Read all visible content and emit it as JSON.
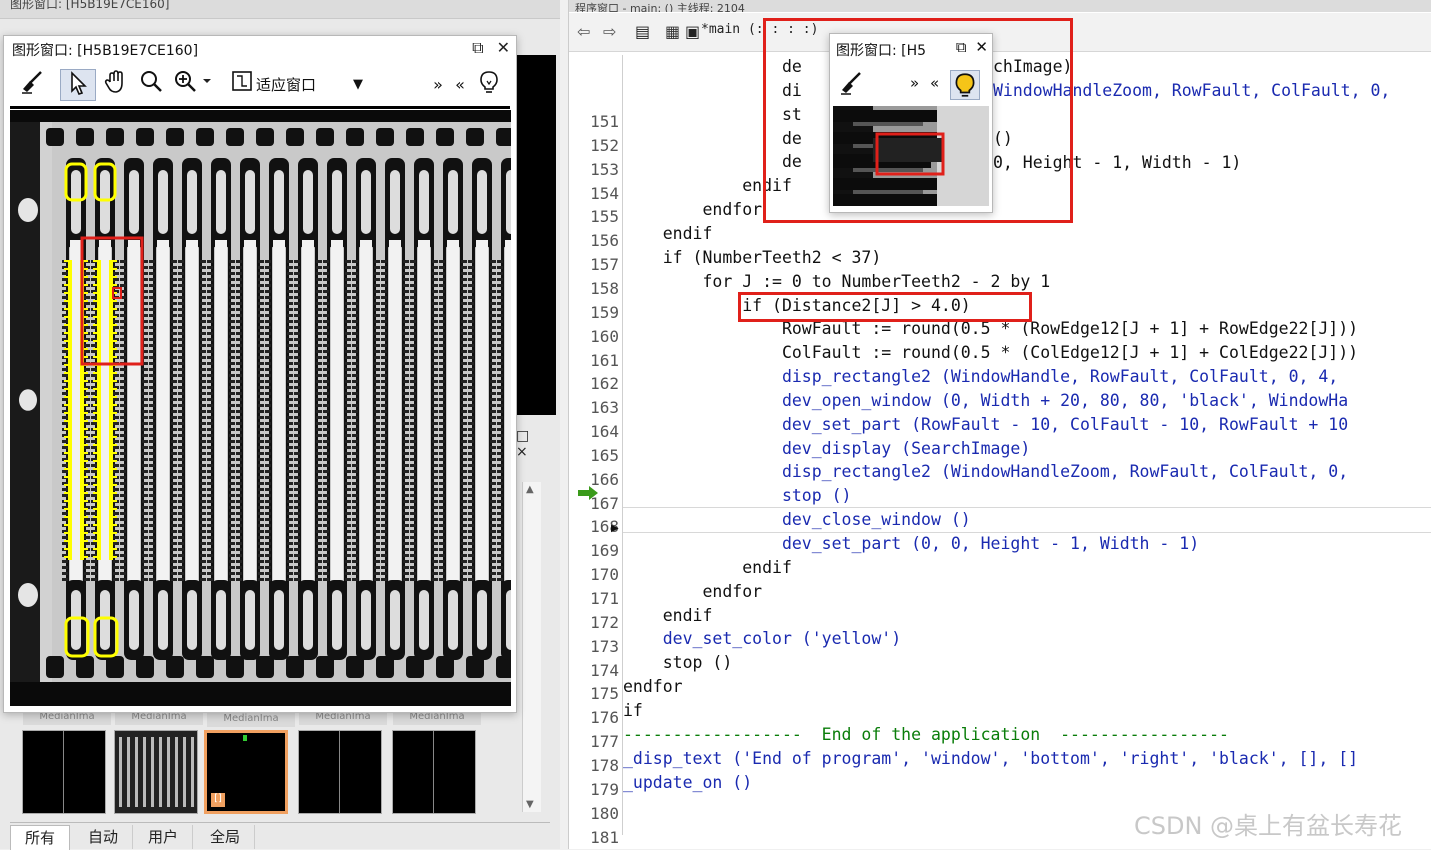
{
  "left_panel": {
    "top_strip_text": "图形窗口: [H5B19E7CE160]",
    "bg_float_controls": [
      "□",
      "×"
    ],
    "thumbnails": [
      {
        "label": "MedianIma"
      },
      {
        "label": "MedianIma"
      },
      {
        "label": "MedianIma"
      },
      {
        "label": "MedianIma"
      },
      {
        "label": "MedianIma"
      }
    ],
    "variable_tabs": [
      "所有",
      "自动",
      "用户",
      "全局"
    ]
  },
  "graphics_window": {
    "title": "图形窗口: [H5B19E7CE160]",
    "float_icon": "⧉",
    "close_icon": "✕",
    "toolbar": {
      "clear_icon": "broom-icon",
      "fit_label": "适应窗口",
      "more": "»",
      "less": "«"
    }
  },
  "zoom_window": {
    "title": "图形窗口: [H5",
    "float_icon": "⧉",
    "close_icon": "✕",
    "more": "»",
    "less": "«"
  },
  "editor": {
    "procedure": "*main (: : : :)",
    "top_strip_text": "程序窗口 - main: ()        主线程: 2104",
    "current_line": 169,
    "lines": [
      {
        "n": "151",
        "text": "                de"
      },
      {
        "n": "152",
        "text": "                di"
      },
      {
        "n": "153",
        "text": "                st"
      },
      {
        "n": "154",
        "text": "                de"
      },
      {
        "n": "155",
        "text": "                de"
      },
      {
        "n": "156",
        "text": "            endif"
      },
      {
        "n": "157",
        "text": "        endfor"
      },
      {
        "n": "158",
        "text": "    endif"
      },
      {
        "n": "159",
        "text": "    if (NumberTeeth2 < 37)"
      },
      {
        "n": "160",
        "text": "        for J := 0 to NumberTeeth2 - 2 by 1"
      },
      {
        "n": "161",
        "text": "            if (Distance2[J] > 4.0)"
      },
      {
        "n": "162",
        "text": "                RowFault := round(0.5 * (RowEdge12[J + 1] + RowEdge22[J]))"
      },
      {
        "n": "163",
        "text": "                ColFault := round(0.5 * (ColEdge12[J + 1] + ColEdge22[J]))"
      },
      {
        "n": "164",
        "text": "                disp_rectangle2 (WindowHandle, RowFault, ColFault, 0, 4,"
      },
      {
        "n": "165",
        "text": "                dev_open_window (0, Width + 20, 80, 80, 'black', WindowHa"
      },
      {
        "n": "166",
        "text": "                dev_set_part (RowFault - 10, ColFault - 10, RowFault + 10"
      },
      {
        "n": "167",
        "text": "                dev_display (SearchImage)"
      },
      {
        "n": "168",
        "text": "                disp_rectangle2 (WindowHandleZoom, RowFault, ColFault, 0,"
      },
      {
        "n": "169",
        "text": "                stop ()"
      },
      {
        "n": "170",
        "text": "                dev_close_window ()"
      },
      {
        "n": "171",
        "text": "                dev_set_part (0, 0, Height - 1, Width - 1)"
      },
      {
        "n": "172",
        "text": "            endif"
      },
      {
        "n": "173",
        "text": "        endfor"
      },
      {
        "n": "174",
        "text": "    endif"
      },
      {
        "n": "175",
        "text": "    dev_set_color ('yellow')"
      },
      {
        "n": "176",
        "text": "    stop ()"
      },
      {
        "n": "177",
        "text": "endfor"
      },
      {
        "n": "178",
        "text": "if"
      },
      {
        "n": "179",
        "text": "------------------  End of the application  -----------------"
      },
      {
        "n": "180",
        "text": "_disp_text ('End of program', 'window', 'bottom', 'right', 'black', [], []"
      },
      {
        "n": "181",
        "text": "_update_on ()"
      }
    ],
    "overflow_fragments": {
      "l151": "chImage)",
      "l152": "WindowHandleZoom, RowFault, ColFault, 0,",
      "l154": "()",
      "l155": "0, Height - 1, Width - 1)"
    }
  },
  "watermark": "CSDN @桌上有盆长寿花",
  "colors": {
    "keyword": "#111111",
    "operator_call": "#1a2ab0",
    "comment": "#0a7d0a",
    "annotation_red": "#e0201a",
    "highlight_yellow": "#ffff00"
  }
}
